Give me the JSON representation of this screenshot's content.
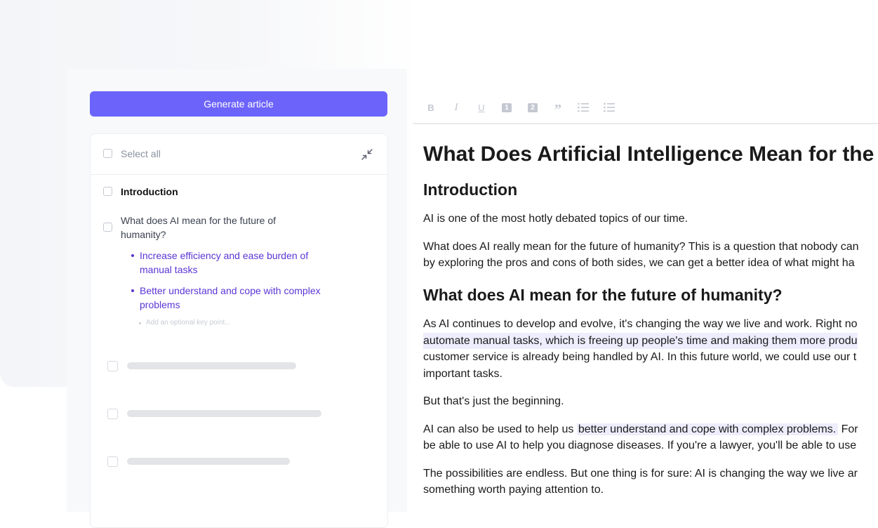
{
  "generate_button": {
    "label": "Generate article"
  },
  "outline": {
    "select_all": "Select all",
    "sections": [
      {
        "title": "Introduction"
      },
      {
        "title_line1": "What does AI mean for the future of",
        "title_line2": "humanity?",
        "key_points": [
          {
            "line1": "Increase efficiency and ease burden of",
            "line2": "manual tasks"
          },
          {
            "line1": "Better understand and cope with complex",
            "line2": "problems"
          }
        ],
        "add_key_point_placeholder": "Add an optional key point..."
      }
    ]
  },
  "toolbar": {
    "icons": [
      "bold-icon",
      "italic-icon",
      "underline-icon",
      "heading-1-icon",
      "heading-2-icon",
      "quote-icon",
      "ordered-list-icon",
      "unordered-list-icon"
    ],
    "glyphs": [
      "B",
      "I",
      "U",
      "1",
      "2",
      "”",
      "",
      ""
    ]
  },
  "article": {
    "title": "What Does Artificial Intelligence Mean for the",
    "h2_intro": "Introduction",
    "p1": "AI is one of the most hotly debated topics of our time.",
    "p2_line1": "What does AI really mean for the future of humanity? This is a question that nobody can",
    "p2_line2": "by exploring the pros and cons of both sides, we can get a better idea of what might ha",
    "h2_future": "What does AI mean for the future of humanity?",
    "p3_line1": "As AI continues to develop and evolve, it's changing the way we live and work. Right no",
    "p3_line2": "automate manual tasks, which is freeing up people's time and making them more produ",
    "p3_line3": "customer service is already being handled by AI. In this future world, we could use our t",
    "p3_line4": "important tasks.",
    "p4": "But that's just the beginning.",
    "p5_line1_a": "AI can also be used to help us ",
    "p5_line1_b": "better understand and cope with complex problems.",
    "p5_line1_c": " For",
    "p5_line2": "be able to use AI to help you diagnose diseases. If you're a lawyer, you'll be able to use",
    "p6_line1": "The possibilities are endless. But one thing is for sure: AI is changing the way we live ar",
    "p6_line2": "something worth paying attention to."
  },
  "colors": {
    "accent": "#6c63fb",
    "key_point": "#5b35d5",
    "highlight": "#eeedfd"
  }
}
